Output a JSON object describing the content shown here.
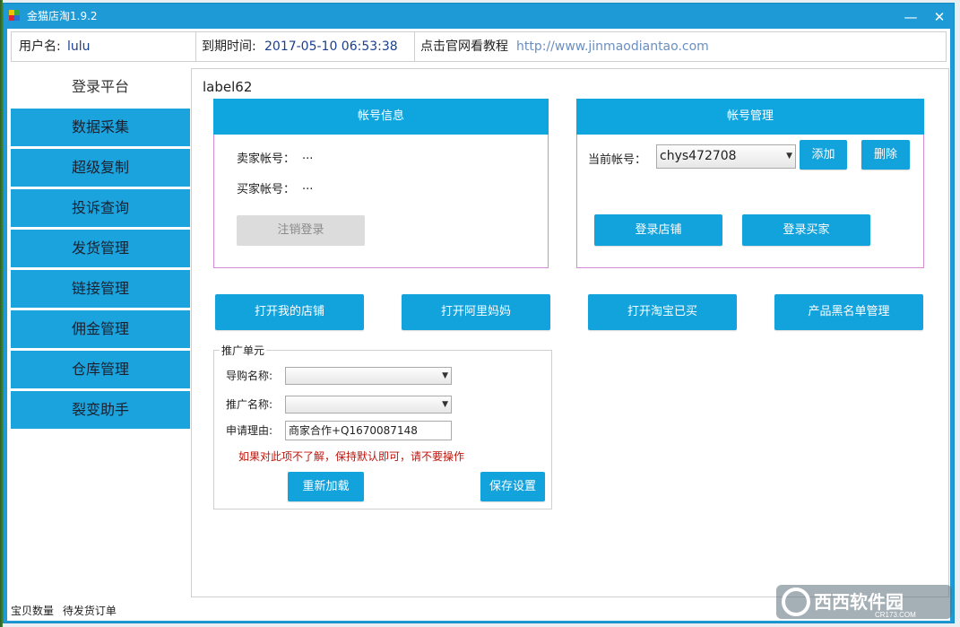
{
  "window": {
    "title": "金猫店淘1.9.2",
    "minimize_glyph": "—",
    "close_glyph": "✕"
  },
  "infobar": {
    "username_label": "用户名:",
    "username": "lulu",
    "expire_label": "到期时间:",
    "expire": "2017-05-10 06:53:38",
    "tutorial_label": "点击官网看教程",
    "url": "http://www.jinmaodiantao.com"
  },
  "sidebar": {
    "items": [
      {
        "label": "登录平台",
        "active": true
      },
      {
        "label": "数据采集"
      },
      {
        "label": "超级复制"
      },
      {
        "label": "投诉查询"
      },
      {
        "label": "发货管理"
      },
      {
        "label": "链接管理"
      },
      {
        "label": "佣金管理"
      },
      {
        "label": "仓库管理"
      },
      {
        "label": "裂变助手"
      }
    ]
  },
  "main": {
    "label": "label62",
    "account_info": {
      "header": "帐号信息",
      "seller_label": "卖家帐号：",
      "seller_value": "...",
      "buyer_label": "买家帐号：",
      "buyer_value": "...",
      "logout_button": "注销登录"
    },
    "account_manage": {
      "header": "帐号管理",
      "current_label": "当前帐号：",
      "current_value": "chys472708",
      "add_button": "添加",
      "delete_button": "删除",
      "login_shop_button": "登录店铺",
      "login_buyer_button": "登录买家"
    },
    "quick_buttons": [
      "打开我的店铺",
      "打开阿里妈妈",
      "打开淘宝已买",
      "产品黑名单管理"
    ],
    "promo": {
      "title": "推广单元",
      "guide_label": "导购名称:",
      "guide_value": "",
      "promo_label": "推广名称:",
      "promo_value": "",
      "reason_label": "申请理由:",
      "reason_value": "商家合作+Q1670087148",
      "warning": "如果对此项不了解，保持默认即可，请不要操作",
      "reload_button": "重新加载",
      "save_button": "保存设置"
    }
  },
  "statusbar": {
    "left": "宝贝数量",
    "right": "待发货订单"
  },
  "watermark": {
    "text": "西西软件园",
    "sub": "CR173.COM"
  },
  "colors": {
    "accent": "#12a2dc",
    "titlebar": "#1e9ad6",
    "warning": "#c0140c",
    "box_border": "#d48ad4"
  }
}
